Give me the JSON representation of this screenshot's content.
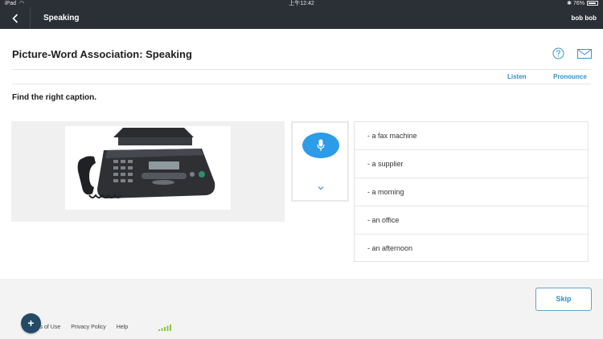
{
  "status_bar": {
    "device": "iPad",
    "time": "上午12:42",
    "battery": "76%"
  },
  "nav": {
    "title": "Speaking",
    "user": "bob bob",
    "back_icon": "chevron-left-icon"
  },
  "header": {
    "title": "Picture-Word Association: Speaking",
    "help_icon": "help-icon",
    "mail_icon": "mail-icon"
  },
  "toolbar": {
    "listen": "Listen",
    "pronounce": "Pronounce"
  },
  "exercise": {
    "instruction": "Find the right caption.",
    "image_subject": "fax machine",
    "mic_icon": "microphone-icon",
    "expand_icon": "chevron-down-icon",
    "options": [
      "- a fax machine",
      "- a supplier",
      "- a morning",
      "- an office",
      "- an afternoon"
    ]
  },
  "footer": {
    "skip": "Skip",
    "links": [
      "Terms of Use",
      "Privacy Policy",
      "Help"
    ],
    "add_button": "+"
  },
  "colors": {
    "nav_bg": "#2b2f36",
    "accent": "#2f90c9",
    "mic": "#2c9be8",
    "footer_bg": "#f3f3f3"
  }
}
